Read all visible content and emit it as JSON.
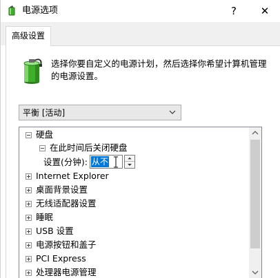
{
  "window": {
    "title": "电源选项",
    "help_glyph": "?",
    "close_glyph": "✕"
  },
  "tabs": [
    {
      "label": "高级设置",
      "selected": true
    }
  ],
  "description": "选择你要自定义的电源计划，然后选择你希望计算机管理的电源设置。",
  "plan": {
    "selected": "平衡 [活动]"
  },
  "tree": {
    "items": [
      {
        "label": "硬盘",
        "state": "expanded"
      },
      {
        "label": "在此时间后关闭硬盘",
        "state": "expanded"
      },
      {
        "label": "Internet Explorer",
        "state": "collapsed"
      },
      {
        "label": "桌面背景设置",
        "state": "collapsed"
      },
      {
        "label": "无线适配器设置",
        "state": "collapsed"
      },
      {
        "label": "睡眠",
        "state": "collapsed"
      },
      {
        "label": "USB 设置",
        "state": "collapsed"
      },
      {
        "label": "电源按钮和盖子",
        "state": "collapsed"
      },
      {
        "label": "PCI Express",
        "state": "collapsed"
      },
      {
        "label": "处理器电源管理",
        "state": "collapsed"
      }
    ],
    "setting": {
      "label": "设置(分钟):",
      "value": "从不"
    }
  },
  "colors": {
    "selection": "#0078d7",
    "battery_green": "#3fae2a",
    "scroll_thumb": "#cdcdcd"
  }
}
